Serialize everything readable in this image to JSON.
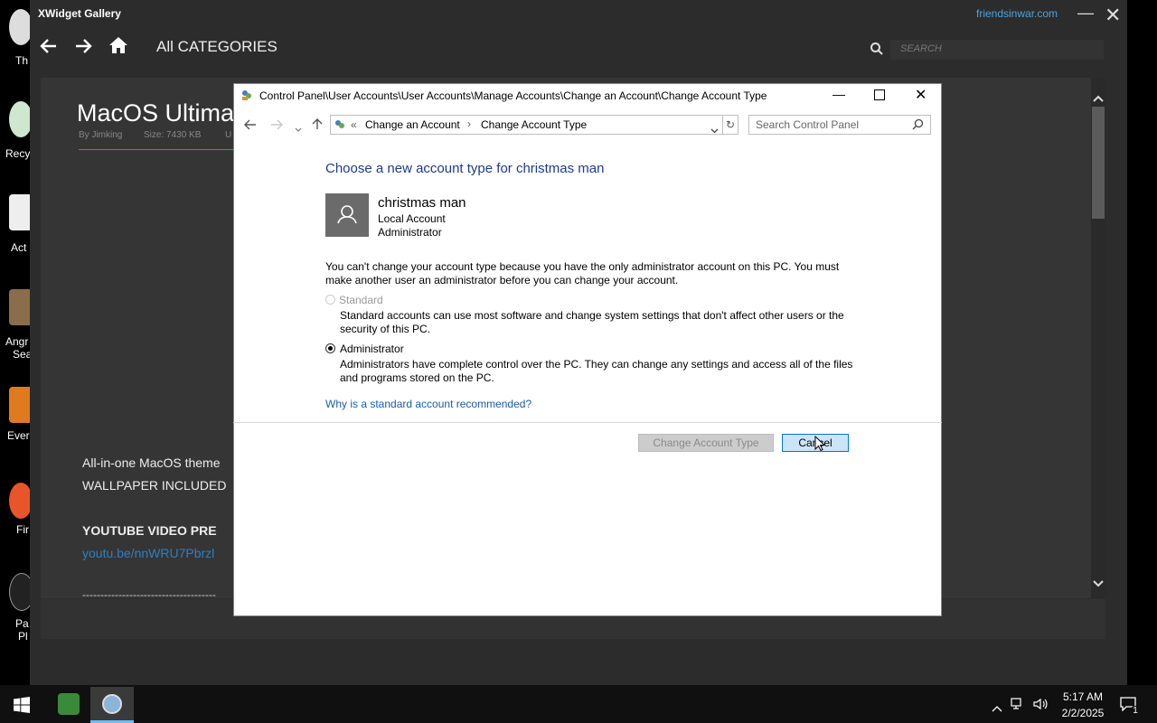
{
  "desktop": {
    "icons": [
      {
        "label": "Th"
      },
      {
        "label": "Recy"
      },
      {
        "label": "Act"
      },
      {
        "label": "Angr"
      },
      {
        "label": "Sea"
      },
      {
        "label": "Ever"
      },
      {
        "label": "Fir"
      },
      {
        "label": "Pa"
      },
      {
        "label": "Pl"
      }
    ]
  },
  "xwidget": {
    "title": "XWidget Gallery",
    "site_link": "friendsinwar.com",
    "category": "All CATEGORIES",
    "search_placeholder": "SEARCH",
    "item_title": "MacOS Ultima",
    "item_author": "By Jimking",
    "item_size": "Size: 7430 KB",
    "item_extra": "U",
    "desc_line1": "All-in-one MacOS theme",
    "desc_line2": "WALLPAPER INCLUDED",
    "video_heading": "YOUTUBE VIDEO PRE",
    "video_link": "youtu.be/nnWRU7Pbrzl",
    "dashes": "-------------------------------------"
  },
  "dialog": {
    "title": "Control Panel\\User Accounts\\User Accounts\\Manage Accounts\\Change an Account\\Change Account Type",
    "breadcrumb_prefix": "«",
    "breadcrumb_1": "Change an Account",
    "breadcrumb_sep": "›",
    "breadcrumb_2": "Change Account Type",
    "search_placeholder": "Search Control Panel",
    "heading": "Choose a new account type for christmas man",
    "account_name": "christmas man",
    "account_type": "Local Account",
    "account_role": "Administrator",
    "warning_line1": "You can't change your account type because you have the only administrator account on this PC. You must",
    "warning_line2": "make another user an administrator before you can change your account.",
    "option_standard": "Standard",
    "standard_desc1": "Standard accounts can use most software and change system settings that don't affect other users or the",
    "standard_desc2": "security of this PC.",
    "option_admin": "Administrator",
    "admin_desc1": "Administrators have complete control over the PC. They can change any settings and access all of the files",
    "admin_desc2": "and programs stored on the PC.",
    "link": "Why is a standard account recommended?",
    "btn_change": "Change Account Type",
    "btn_cancel": "Cancel"
  },
  "taskbar": {
    "time": "5:17 AM",
    "date": "2/2/2025",
    "notification_count": "1"
  }
}
